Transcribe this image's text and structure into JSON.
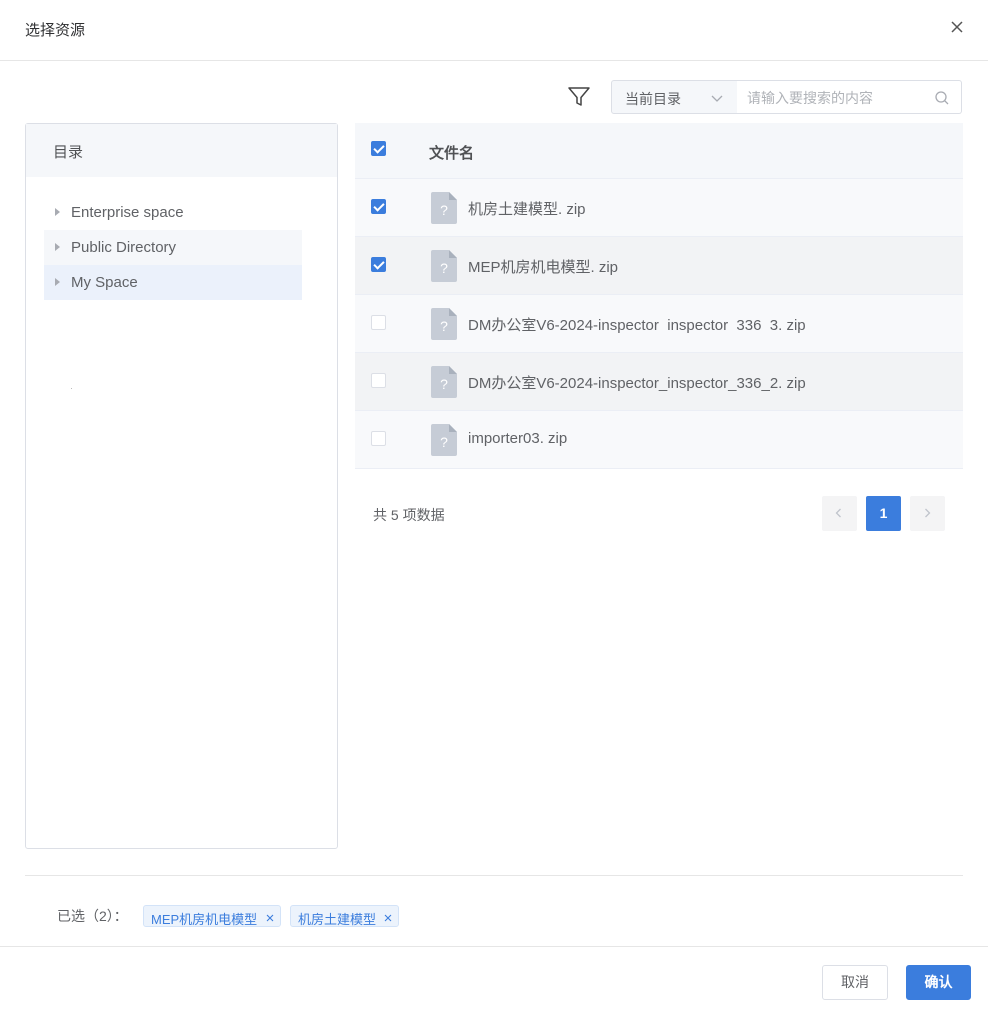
{
  "dialog": {
    "title": "选择资源"
  },
  "toolbar": {
    "scope_label": "当前目录",
    "search_placeholder": "请输入要搜索的内容"
  },
  "tree": {
    "header": "目录",
    "items": [
      {
        "label": "Enterprise space",
        "state": "normal"
      },
      {
        "label": "Public Directory",
        "state": "hover"
      },
      {
        "label": "My Space",
        "state": "selected"
      }
    ]
  },
  "table": {
    "column_header": "文件名",
    "header_checked": true,
    "rows": [
      {
        "name": "机房土建模型. zip",
        "checked": true
      },
      {
        "name": "MEP机房机电模型. zip",
        "checked": true
      },
      {
        "name": "DM办公室V6-2024-inspector  inspector  336  3. zip",
        "checked": false
      },
      {
        "name": "DM办公室V6-2024-inspector_inspector_336_2. zip",
        "checked": false
      },
      {
        "name": "importer03. zip",
        "checked": false
      }
    ]
  },
  "pagination": {
    "total_text": "共 5 项数据",
    "current_page": "1"
  },
  "selected": {
    "label": "已选（2）：",
    "tags": [
      "MEP机房机电模型",
      "机房土建模型"
    ]
  },
  "footer": {
    "cancel_label": "取消",
    "confirm_label": "确认"
  },
  "colors": {
    "primary": "#3b7ddd",
    "tag_bg": "#ecf3fc",
    "panel_header_bg": "#f5f7fa"
  }
}
